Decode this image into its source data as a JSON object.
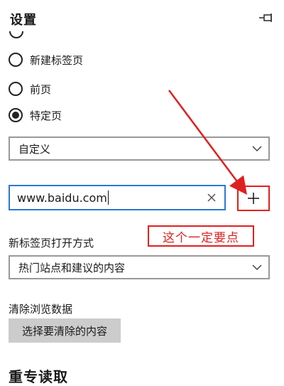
{
  "panel": {
    "title": "设置"
  },
  "startup": {
    "options": [
      {
        "label": "新建标签页",
        "selected": false
      },
      {
        "label": "前页",
        "selected": false
      },
      {
        "label": "特定页",
        "selected": true
      }
    ],
    "page_select_value": "自定义",
    "url_value": "www.baidu.com"
  },
  "annotation": {
    "text": "这个一定要点"
  },
  "new_tab": {
    "label": "新标签页打开方式",
    "select_value": "热门站点和建议的内容"
  },
  "clear_data": {
    "label": "清除浏览数据",
    "button_label": "选择要清除的内容"
  },
  "next_section": {
    "label": "重专读取"
  },
  "icons": {
    "pin": "pin-icon",
    "chevron": "chevron-down-icon",
    "clear": "close-icon",
    "add": "plus-icon"
  },
  "colors": {
    "accent_blue": "#2b78d3",
    "annotation_red": "#e02020",
    "button_gray": "#cccccc"
  }
}
